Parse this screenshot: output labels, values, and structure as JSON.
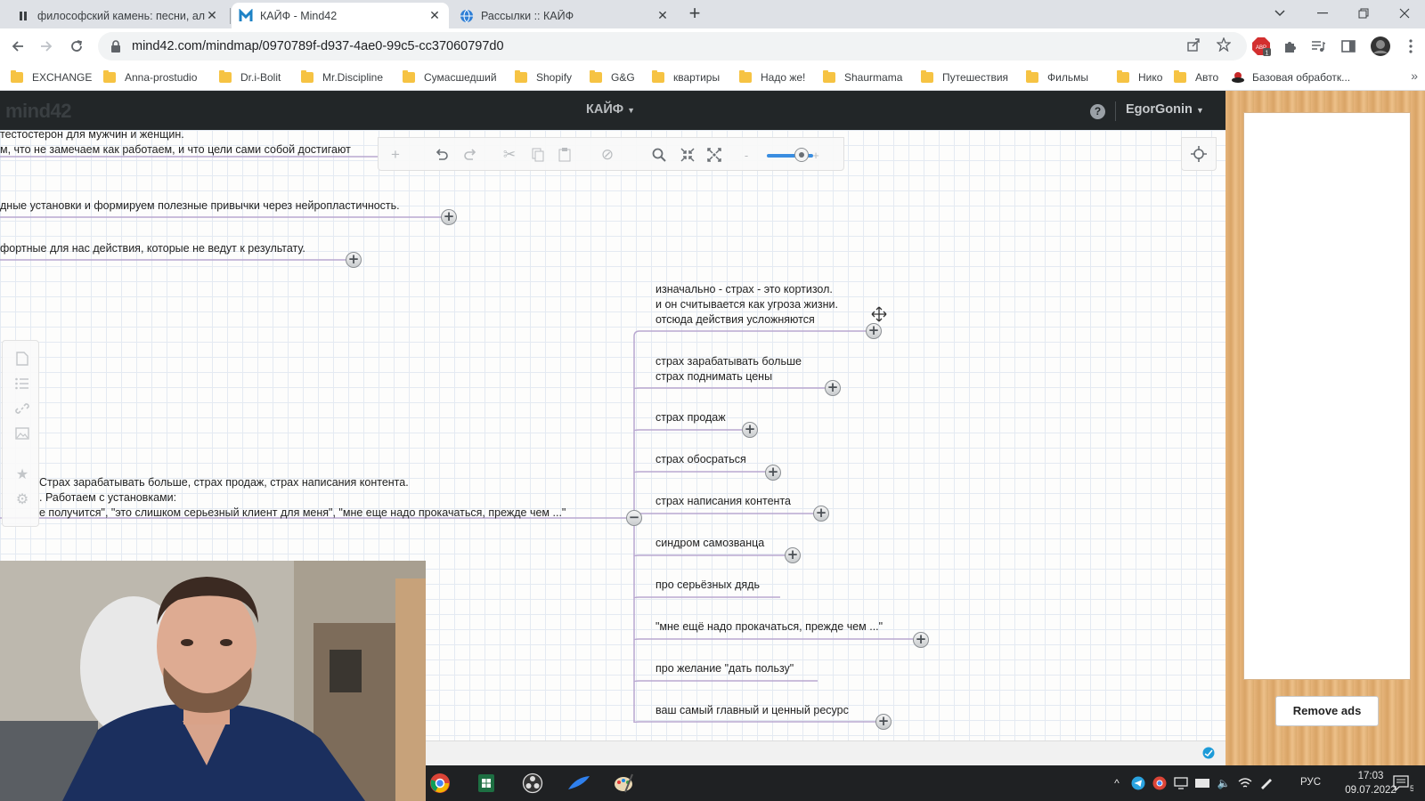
{
  "browser": {
    "tabs": [
      {
        "title": "философский камень: песни, ал",
        "active": false,
        "icon": "pause-icon"
      },
      {
        "title": "КАЙФ - Mind42",
        "active": true,
        "icon": "mind42-icon"
      },
      {
        "title": "Рассылки :: КАЙФ",
        "active": false,
        "icon": "globe-icon"
      }
    ],
    "url": "mind42.com/mindmap/0970789f-d937-4ae0-99c5-cc37060797d0",
    "bookmarks": [
      "EXCHANGE",
      "Anna-prostudio",
      "Dr.i-Bolit",
      "Mr.Discipline",
      "Сумасшедший",
      "Shopify",
      "G&G",
      "квартиры",
      "Надо же!",
      "Shaurmama",
      "Путешествия",
      "Фильмы",
      "Нико",
      "Авто",
      "Базовая обработк..."
    ],
    "ext_badge": "ABP",
    "ext_count": "1"
  },
  "app": {
    "logo": "mind42",
    "map_name": "КАЙФ",
    "user": "EgorGonin",
    "help": "?",
    "remove_ads": "Remove ads"
  },
  "mindmap": {
    "left_nodes": [
      {
        "id": "ln1",
        "text": "тестостерон для мужчин и женщин.\nм, что не замечаем как работаем, и что цели сами собой достигают"
      },
      {
        "id": "ln2",
        "text": "дные установки и формируем полезные привычки через нейропластичность."
      },
      {
        "id": "ln3",
        "text": "фортные для нас действия, которые не ведут к результату."
      },
      {
        "id": "ln4",
        "text": "Страх зарабатывать больше, страх продаж, страх написания контента.\n. Работаем с установками:\nе получится\", \"это слишком серьезный клиент для меня\", \"мне еще надо прокачаться, прежде чем ...\""
      }
    ],
    "right_nodes": [
      {
        "id": "rn1",
        "text": "изначально - страх - это кортизол.\nи он считывается как угроза жизни.\nотсюда действия усложняются",
        "expander": "+"
      },
      {
        "id": "rn2",
        "text": "страх зарабатывать больше\nстрах поднимать цены",
        "expander": "+"
      },
      {
        "id": "rn3",
        "text": "страх продаж",
        "expander": "+"
      },
      {
        "id": "rn4",
        "text": "страх обосраться",
        "expander": "+"
      },
      {
        "id": "rn5",
        "text": "страх написания контента",
        "expander": "+"
      },
      {
        "id": "rn6",
        "text": "синдром самозванца",
        "expander": "+"
      },
      {
        "id": "rn7",
        "text": "про серьёзных дядь",
        "expander": ""
      },
      {
        "id": "rn8",
        "text": "\"мне ещё надо прокачаться, прежде чем ...\"",
        "expander": "+"
      },
      {
        "id": "rn9",
        "text": "про желание \"дать пользу\"",
        "expander": ""
      },
      {
        "id": "rn10",
        "text": "ваш самый главный и ценный ресурс",
        "expander": "+"
      }
    ],
    "collapse_symbol": "−",
    "zoom_level_fraction": 0.75
  },
  "taskbar": {
    "language": "РУС",
    "time": "17:03",
    "date": "09.07.2022",
    "notifications": "5"
  }
}
